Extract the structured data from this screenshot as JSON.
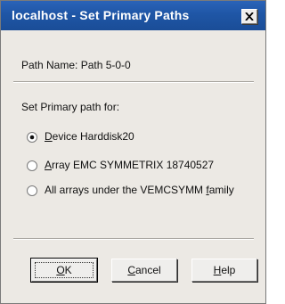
{
  "window": {
    "title": "localhost - Set Primary Paths",
    "close_icon": "close-icon"
  },
  "path_name": "Path Name: Path 5-0-0",
  "group_label": "Set Primary path for:",
  "options": [
    {
      "label_prefix": "",
      "label_mnemonic": "D",
      "label_rest": "evice Harddisk20",
      "selected": true
    },
    {
      "label_prefix": "",
      "label_mnemonic": "A",
      "label_rest": "rray EMC SYMMETRIX 18740527",
      "selected": false
    },
    {
      "label_prefix": "All arrays under the VEMCSYMM ",
      "label_mnemonic": "f",
      "label_rest": "amily",
      "selected": false
    }
  ],
  "buttons": {
    "ok": {
      "mnemonic": "O",
      "rest": "K"
    },
    "cancel": {
      "mnemonic": "C",
      "rest": "ancel"
    },
    "help": {
      "mnemonic": "H",
      "rest": "elp"
    }
  },
  "colors": {
    "titlebar": "#1f56a6",
    "dialog_bg": "#ece9e4"
  }
}
